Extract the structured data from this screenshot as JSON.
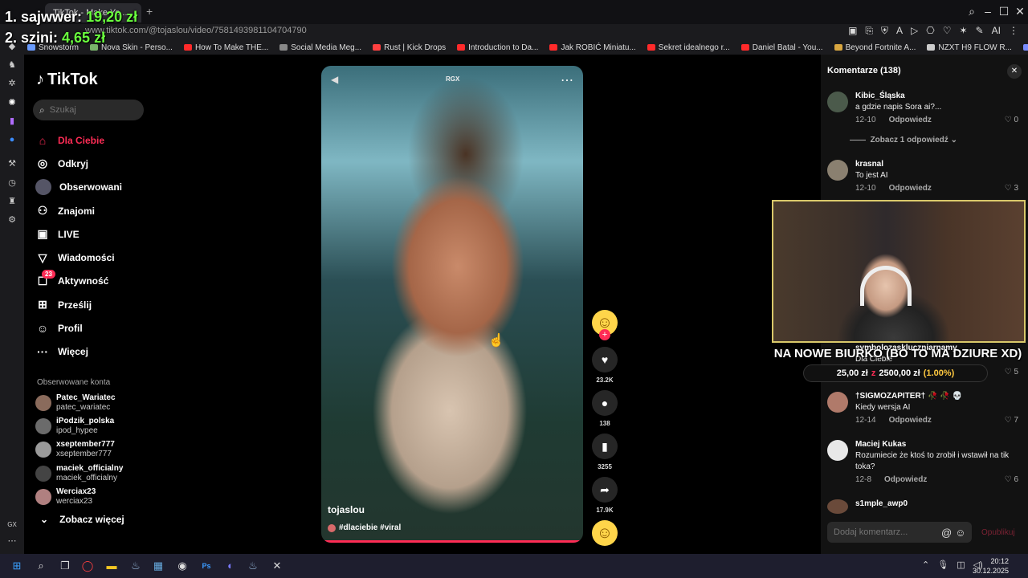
{
  "overlay": {
    "donor1_label": "1. sajwwer:",
    "donor1_amount": "19,20 zł",
    "donor2_label": "2. szini:",
    "donor2_amount": "4,65 zł"
  },
  "browser": {
    "tab_title": "TikTok - Make Yo...",
    "url": "www.tiktok.com/@tojaslou/video/7581493981104704790",
    "extensions": [
      "▣",
      "⎘",
      "⛨",
      "A",
      "▷",
      "⎔",
      "♡",
      "✶",
      "✎",
      "AI",
      "⋮"
    ],
    "ext_ai": "AI"
  },
  "bookmarks": [
    {
      "label": "Snowstorm",
      "color": "#6a9cff"
    },
    {
      "label": "Nova Skin - Perso...",
      "color": "#79b36b"
    },
    {
      "label": "How To Make THE...",
      "color": "#ff2a2a"
    },
    {
      "label": "Social Media Meg...",
      "color": "#888888"
    },
    {
      "label": "Rust | Kick Drops",
      "color": "#ff4040"
    },
    {
      "label": "Introduction to Da...",
      "color": "#ff2a2a"
    },
    {
      "label": "Jak ROBIĆ Miniatu...",
      "color": "#ff2a2a"
    },
    {
      "label": "Sekret idealnego r...",
      "color": "#ff2a2a"
    },
    {
      "label": "Daniel Batal - You...",
      "color": "#ff2a2a"
    },
    {
      "label": "Beyond Fortnite A...",
      "color": "#d8a640"
    },
    {
      "label": "NZXT H9 FLOW R...",
      "color": "#cccccc"
    },
    {
      "label": "Kylnn's Photosho...",
      "color": "#7a8cff"
    }
  ],
  "tiktok": {
    "logo": "TikTok",
    "search_placeholder": "Szukaj",
    "nav": [
      {
        "label": "Dla Ciebie",
        "icon": "home-icon",
        "glyph": "⌂"
      },
      {
        "label": "Odkryj",
        "icon": "compass-icon",
        "glyph": "◎"
      },
      {
        "label": "Obserwowani",
        "icon": "avatar-icon",
        "glyph": "●"
      },
      {
        "label": "Znajomi",
        "icon": "friends-icon",
        "glyph": "⚇"
      },
      {
        "label": "LIVE",
        "icon": "live-icon",
        "glyph": "▣"
      },
      {
        "label": "Wiadomości",
        "icon": "send-icon",
        "glyph": "▽"
      },
      {
        "label": "Aktywność",
        "icon": "activity-icon",
        "glyph": "☐"
      },
      {
        "label": "Prześlij",
        "icon": "upload-icon",
        "glyph": "⊞"
      },
      {
        "label": "Profil",
        "icon": "profile-icon",
        "glyph": "☺"
      },
      {
        "label": "Więcej",
        "icon": "more-icon",
        "glyph": "···"
      }
    ],
    "activity_badge": "23",
    "followed_title": "Obserwowane konta",
    "followed": [
      {
        "name": "Patec_Wariatec",
        "handle": "patec_wariatec",
        "color": "#8a6b5c"
      },
      {
        "name": "iPodzik_polska",
        "handle": "ipod_hypee",
        "color": "#6b6b6b"
      },
      {
        "name": "xseptember777",
        "handle": "xseptember777",
        "color": "#9a9a9a"
      },
      {
        "name": "maciek_officialny",
        "handle": "maciek_officialny",
        "color": "#444444"
      },
      {
        "name": "Werciax23",
        "handle": "werciax23",
        "color": "#b08080"
      }
    ],
    "see_more": "Zobacz więcej"
  },
  "video": {
    "top_label": "RGX",
    "author": "tojaslou",
    "tags": "#dlaciebie #viral",
    "progress": 1.0,
    "likes": "23.2K",
    "comments": "138",
    "saves": "3255",
    "shares": "17.9K"
  },
  "comments": {
    "header": "Komentarze (138)",
    "items": [
      {
        "user": "Kibic_Śląska",
        "text": "a gdzie napis Sora ai?...",
        "date": "12-10",
        "reply": "Odpowiedz",
        "likes": "0"
      },
      {
        "user": "krasnal",
        "text": "To jest AI",
        "date": "12-10",
        "reply": "Odpowiedz",
        "likes": "3"
      },
      {
        "user": "symbolozaskluczniarnamy",
        "text": "Dla Ciebie",
        "date": "",
        "reply": "",
        "likes": "5"
      },
      {
        "user": "†SIGMOZAPITER† 🥀 🥀 💀",
        "text": "Kiedy wersja AI",
        "date": "12-14",
        "reply": "Odpowiedz",
        "likes": "7"
      },
      {
        "user": "Maciej Kukas",
        "text": "Rozumiecie że ktoś to zrobił i wstawił na tik toka?",
        "date": "12-8",
        "reply": "Odpowiedz",
        "likes": "6"
      },
      {
        "user": "s1mple_awp0",
        "text": "",
        "date": "",
        "reply": "",
        "likes": ""
      }
    ],
    "view_replies": "Zobacz 1 odpowiedź",
    "input_placeholder": "Dodaj komentarz...",
    "post_label": "Opublikuj"
  },
  "stream": {
    "caption": "NA NOWE BIURKO (BO TO MA DZIURE XD)",
    "goal_current": "25,00 zł",
    "goal_of": "z",
    "goal_target": "2500,00 zł",
    "goal_percent": "(1.00%)"
  },
  "taskbar": {
    "time": "20:12",
    "date": "30.12.2025"
  }
}
